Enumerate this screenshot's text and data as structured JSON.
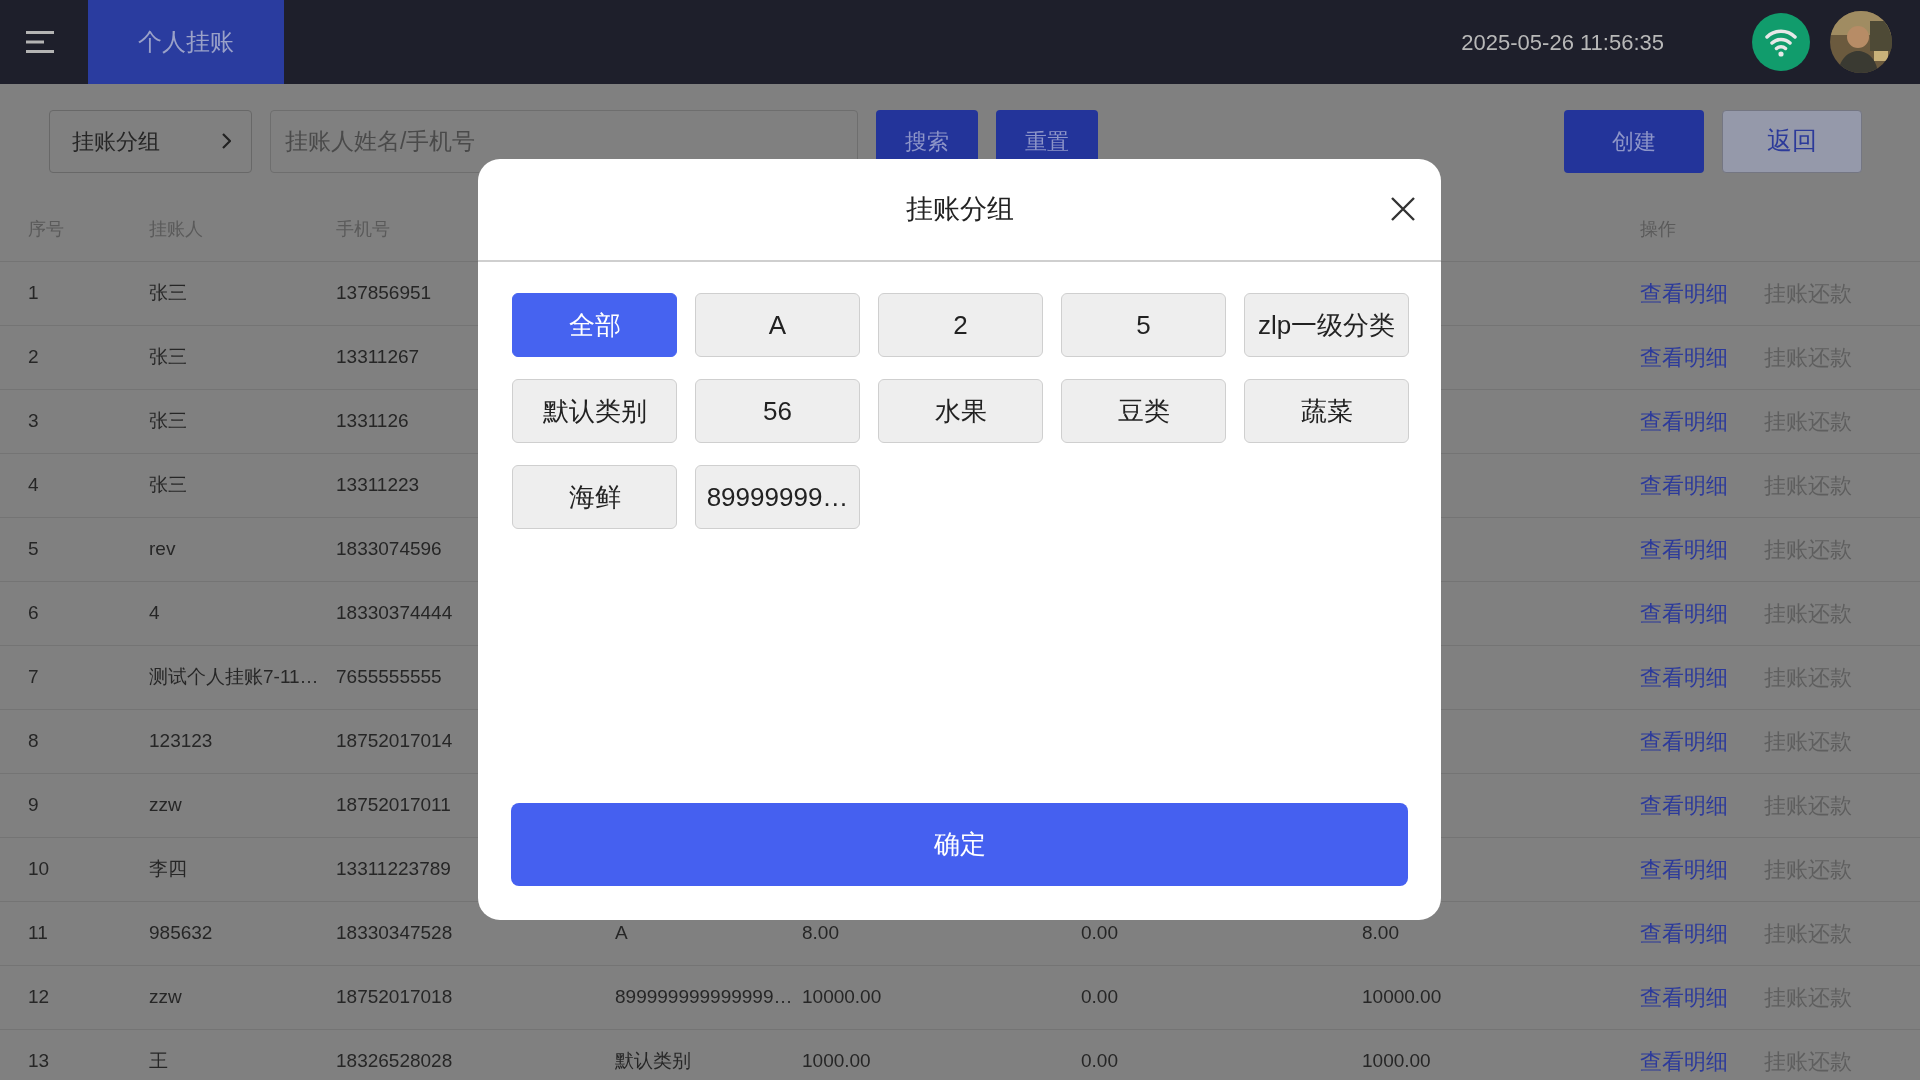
{
  "top_bar": {
    "tab": {
      "label": "个人挂账",
      "selected": true
    },
    "datetime": "2025-05-26 11:56:35"
  },
  "toolbar": {
    "group_button": "挂账分组",
    "search": {
      "placeholder": "挂账人姓名/手机号"
    },
    "left_buttons": [
      {
        "label": "搜索",
        "kind": "primary"
      },
      {
        "label": "重置",
        "kind": "primary"
      }
    ],
    "right_buttons": [
      {
        "label": "创建",
        "kind": "primary"
      },
      {
        "label": "返回",
        "kind": "secondary"
      }
    ]
  },
  "table": {
    "columns": [
      "序号",
      "挂账人",
      "手机号"
    ],
    "action_column": "操作",
    "rows": [
      {
        "no": "1",
        "name": "张三",
        "phone": "137856951",
        "actions": [
          {
            "label": "查看明细",
            "kind": "link"
          },
          {
            "label": "挂账还款",
            "kind": "plain"
          }
        ]
      },
      {
        "no": "2",
        "name": "张三",
        "phone": "13311267",
        "actions": [
          {
            "label": "查看明细",
            "kind": "link"
          },
          {
            "label": "挂账还款",
            "kind": "plain"
          }
        ]
      },
      {
        "no": "3",
        "name": "张三",
        "phone": "1331126",
        "actions": [
          {
            "label": "查看明细",
            "kind": "link"
          },
          {
            "label": "挂账还款",
            "kind": "plain"
          }
        ]
      },
      {
        "no": "4",
        "name": "张三",
        "phone": "13311223",
        "actions": [
          {
            "label": "查看明细",
            "kind": "link"
          },
          {
            "label": "挂账还款",
            "kind": "plain"
          }
        ]
      },
      {
        "no": "5",
        "name": "rev",
        "phone": "1833074596",
        "actions": [
          {
            "label": "查看明细",
            "kind": "link"
          },
          {
            "label": "挂账还款",
            "kind": "plain"
          }
        ]
      },
      {
        "no": "6",
        "name": "4",
        "phone": "18330374444",
        "actions": [
          {
            "label": "查看明细",
            "kind": "link"
          },
          {
            "label": "挂账还款",
            "kind": "plain"
          }
        ]
      },
      {
        "no": "7",
        "name": "测试个人挂账7-11…",
        "phone": "7655555555",
        "actions": [
          {
            "label": "查看明细",
            "kind": "link"
          },
          {
            "label": "挂账还款",
            "kind": "plain"
          }
        ]
      },
      {
        "no": "8",
        "name": "123123",
        "phone": "18752017014",
        "actions": [
          {
            "label": "查看明细",
            "kind": "link"
          },
          {
            "label": "挂账还款",
            "kind": "plain"
          }
        ]
      },
      {
        "no": "9",
        "name": "zzw",
        "phone": "18752017011",
        "actions": [
          {
            "label": "查看明细",
            "kind": "link"
          },
          {
            "label": "挂账还款",
            "kind": "plain"
          }
        ]
      },
      {
        "no": "10",
        "name": "李四",
        "phone": "13311223789",
        "actions": [
          {
            "label": "查看明细",
            "kind": "link"
          },
          {
            "label": "挂账还款",
            "kind": "plain"
          }
        ]
      },
      {
        "no": "11",
        "name": "985632",
        "phone": "18330347528",
        "group": "A",
        "column_5": "8.00",
        "column_6": "0.00",
        "column_7": "8.00",
        "actions": [
          {
            "label": "查看明细",
            "kind": "link"
          },
          {
            "label": "挂账还款",
            "kind": "plain"
          }
        ]
      },
      {
        "no": "12",
        "name": "zzw",
        "phone": "18752017018",
        "group": "899999999999999…",
        "column_5": "10000.00",
        "column_6": "0.00",
        "column_7": "10000.00",
        "actions": [
          {
            "label": "查看明细",
            "kind": "link"
          },
          {
            "label": "挂账还款",
            "kind": "plain"
          }
        ]
      },
      {
        "no": "13",
        "name": "王",
        "phone": "18326528028",
        "group": "默认类别",
        "column_5": "1000.00",
        "column_6": "0.00",
        "column_7": "1000.00",
        "actions": [
          {
            "label": "查看明细",
            "kind": "link"
          },
          {
            "label": "挂账还款",
            "kind": "plain"
          }
        ]
      }
    ]
  },
  "modal": {
    "title": "挂账分组",
    "options": [
      {
        "label": "全部",
        "selected": true
      },
      {
        "label": "A",
        "selected": false
      },
      {
        "label": "2",
        "selected": false
      },
      {
        "label": "5",
        "selected": false
      },
      {
        "label": "zlp一级分类",
        "selected": false
      },
      {
        "label": "默认类别",
        "selected": false
      },
      {
        "label": "56",
        "selected": false
      },
      {
        "label": "水果",
        "selected": false
      },
      {
        "label": "豆类",
        "selected": false
      },
      {
        "label": "蔬菜",
        "selected": false
      },
      {
        "label": "海鲜",
        "selected": false
      },
      {
        "label": "89999999…",
        "selected": false
      }
    ],
    "confirm": "确定"
  }
}
